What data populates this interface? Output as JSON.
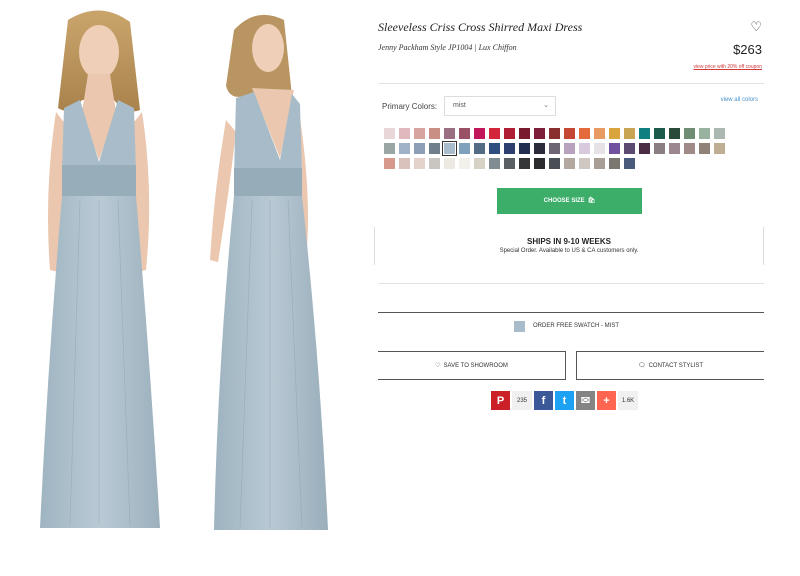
{
  "product": {
    "title": "Sleeveless Criss Cross Shirred Maxi Dress",
    "designer_style": "Jenny Packham Style JP1004",
    "separator": "|",
    "fabric": "Lux Chiffon",
    "price": "$263",
    "promo": "view price with 20% off coupon"
  },
  "colors": {
    "label": "Primary Colors:",
    "selected": "mist",
    "view_all": "view all colors",
    "rows": [
      [
        "#e9d6d8",
        "#e0b8bd",
        "#d7a49f",
        "#c98e84",
        "#9b6e82",
        "#9a5165",
        "#c2185b",
        "#d3263a",
        "#b01e33",
        "#7a1a2e",
        "#7d1f3a",
        "#8a2f2f",
        "#c44834",
        "#e46a3c",
        "#e89a63",
        "#d9a43b",
        "#c8a455",
        "#0f7f80",
        "#1c5b4c",
        "#2a4a3a",
        "#6f8d72",
        "#98b2a0",
        "#aab8b1"
      ],
      [
        "#9aa6a3",
        "#9fb2c8",
        "#8c9fb7",
        "#6f7f8c",
        "#a8bccb",
        "#7ea1be",
        "#536c86",
        "#2c4f80",
        "#2c3f6e",
        "#232f50",
        "#2b2b3b",
        "#6d6574",
        "#b8a2bd",
        "#d8c9dc",
        "#e6e2e6",
        "#7052a0",
        "#5c4a70",
        "#4a2c45",
        "#8a7e83",
        "#9c8690",
        "#a08a88",
        "#8f8378",
        "#bfae94"
      ],
      [
        "#d59a8c",
        "#d9c2bb",
        "#e3d3cb",
        "#c9c5c0",
        "#ece9e2",
        "#f2f0ea",
        "#d6d2c6",
        "#7f8c92",
        "#5a5f63",
        "#343638",
        "#2d2d30",
        "#4a4f55",
        "#b3a7a0",
        "#cfc8c2",
        "#a89e96",
        "#7b7670",
        "#4a5a7a"
      ]
    ]
  },
  "choose_size": {
    "label": "CHOOSE SIZE",
    "icon": "bag-icon"
  },
  "shipping": {
    "title": "SHIPS IN 9-10 WEEKS",
    "note": "Special Order. Available to US & CA customers only."
  },
  "swatch_order": {
    "label": "ORDER FREE SWATCH - MIST",
    "color": "#a9bccb"
  },
  "actions": {
    "save_showroom": "SAVE TO SHOWROOM",
    "contact_stylist": "CONTACT STYLIST"
  },
  "share": {
    "pinterest_count": "235",
    "total_count": "1.6K",
    "pinterest_color": "#cb2027",
    "facebook_color": "#3b5998",
    "twitter_color": "#1da1f2",
    "email_color": "#848484",
    "more_color": "#ff6550"
  }
}
